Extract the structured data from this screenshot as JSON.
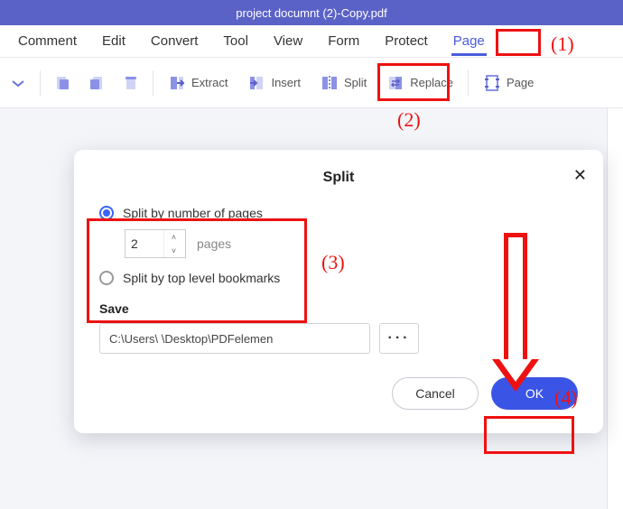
{
  "titlebar": {
    "filename": "project documnt (2)-Copy.pdf"
  },
  "menu": {
    "items": [
      "Comment",
      "Edit",
      "Convert",
      "Tool",
      "View",
      "Form",
      "Protect",
      "Page"
    ],
    "active": "Page"
  },
  "toolbar": {
    "extract": "Extract",
    "insert": "Insert",
    "split": "Split",
    "replace": "Replace",
    "page": "Page"
  },
  "dialog": {
    "title": "Split",
    "opt_pages": "Split by number of pages",
    "pages_value": "2",
    "pages_unit": "pages",
    "opt_bookmarks": "Split by top level bookmarks",
    "save_label": "Save",
    "save_path": "C:\\Users\\                      \\Desktop\\PDFelemen",
    "browse": "···",
    "cancel": "Cancel",
    "ok": "OK"
  },
  "annotations": {
    "n1": "(1)",
    "n2": "(2)",
    "n3": "(3)",
    "n4": "(4)"
  }
}
